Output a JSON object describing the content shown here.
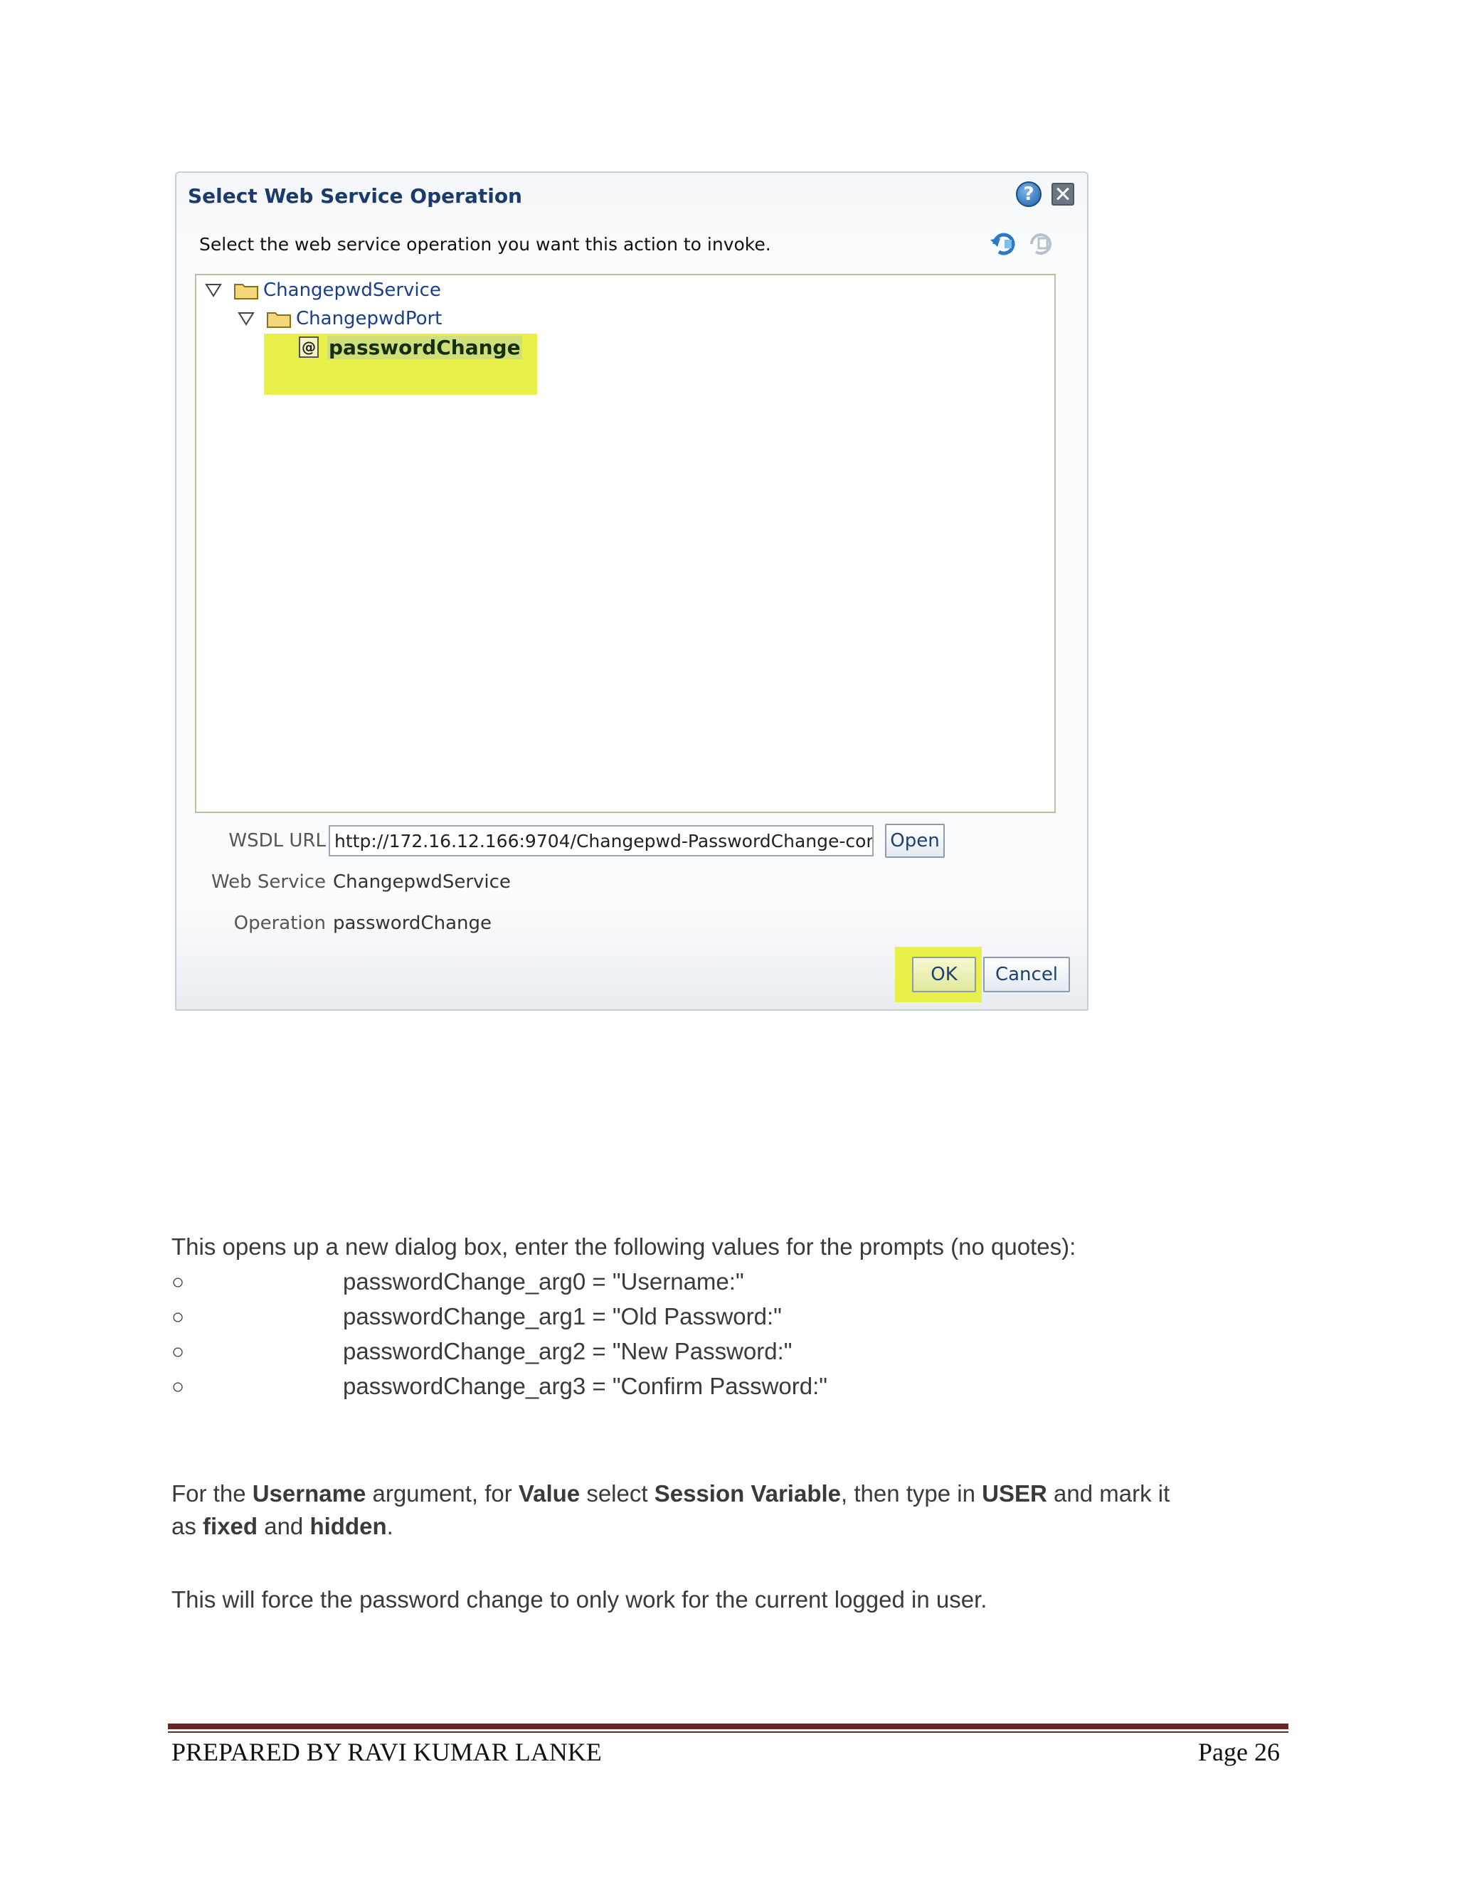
{
  "dialog": {
    "title": "Select Web Service Operation",
    "help_label": "?",
    "instruction": "Select the web service operation you want this action to invoke.",
    "tree": {
      "service": "ChangepwdService",
      "port": "ChangepwdPort",
      "operation_icon": "@",
      "operation": "passwordChange"
    },
    "fields": {
      "wsdl_label": "WSDL URL",
      "wsdl_value": "http://172.16.12.166:9704/Changepwd-PasswordChange-con",
      "open_label": "Open",
      "service_label": "Web Service",
      "service_value": "ChangepwdService",
      "operation_label": "Operation",
      "operation_value": "passwordChange"
    },
    "buttons": {
      "ok": "OK",
      "cancel": "Cancel"
    },
    "icons": [
      "help-icon",
      "close-icon",
      "refresh-icon",
      "refresh-disabled-icon",
      "folder-icon",
      "expand-triangle-icon",
      "operation-icon"
    ],
    "highlight_color": "#eaf04a"
  },
  "document": {
    "intro": "This opens up a new dialog box, enter the following values for the prompts (no quotes):",
    "bullet_symbol": "○",
    "bullets": [
      "passwordChange_arg0 = \"Username:\"",
      "passwordChange_arg1 = \"Old Password:\"",
      "passwordChange_arg2 = \"New Password:\"",
      "passwordChange_arg3 = \"Confirm Password:\""
    ],
    "para1": {
      "t1": "For the ",
      "b1": "Username",
      "t2": " argument, for ",
      "b2": "Value",
      "t3": " select ",
      "b3": "Session Variable",
      "t4": ", then type in ",
      "b4": "USER",
      "t5": " and mark it",
      "t6": "as ",
      "b5": "fixed",
      "t7": " and ",
      "b6": "hidden",
      "t8": "."
    },
    "para2": "This will force the password change to only work for the current logged in user."
  },
  "footer": {
    "left": "PREPARED BY RAVI KUMAR LANKE",
    "right": "Page 26",
    "rule_color": "#6b2424"
  }
}
